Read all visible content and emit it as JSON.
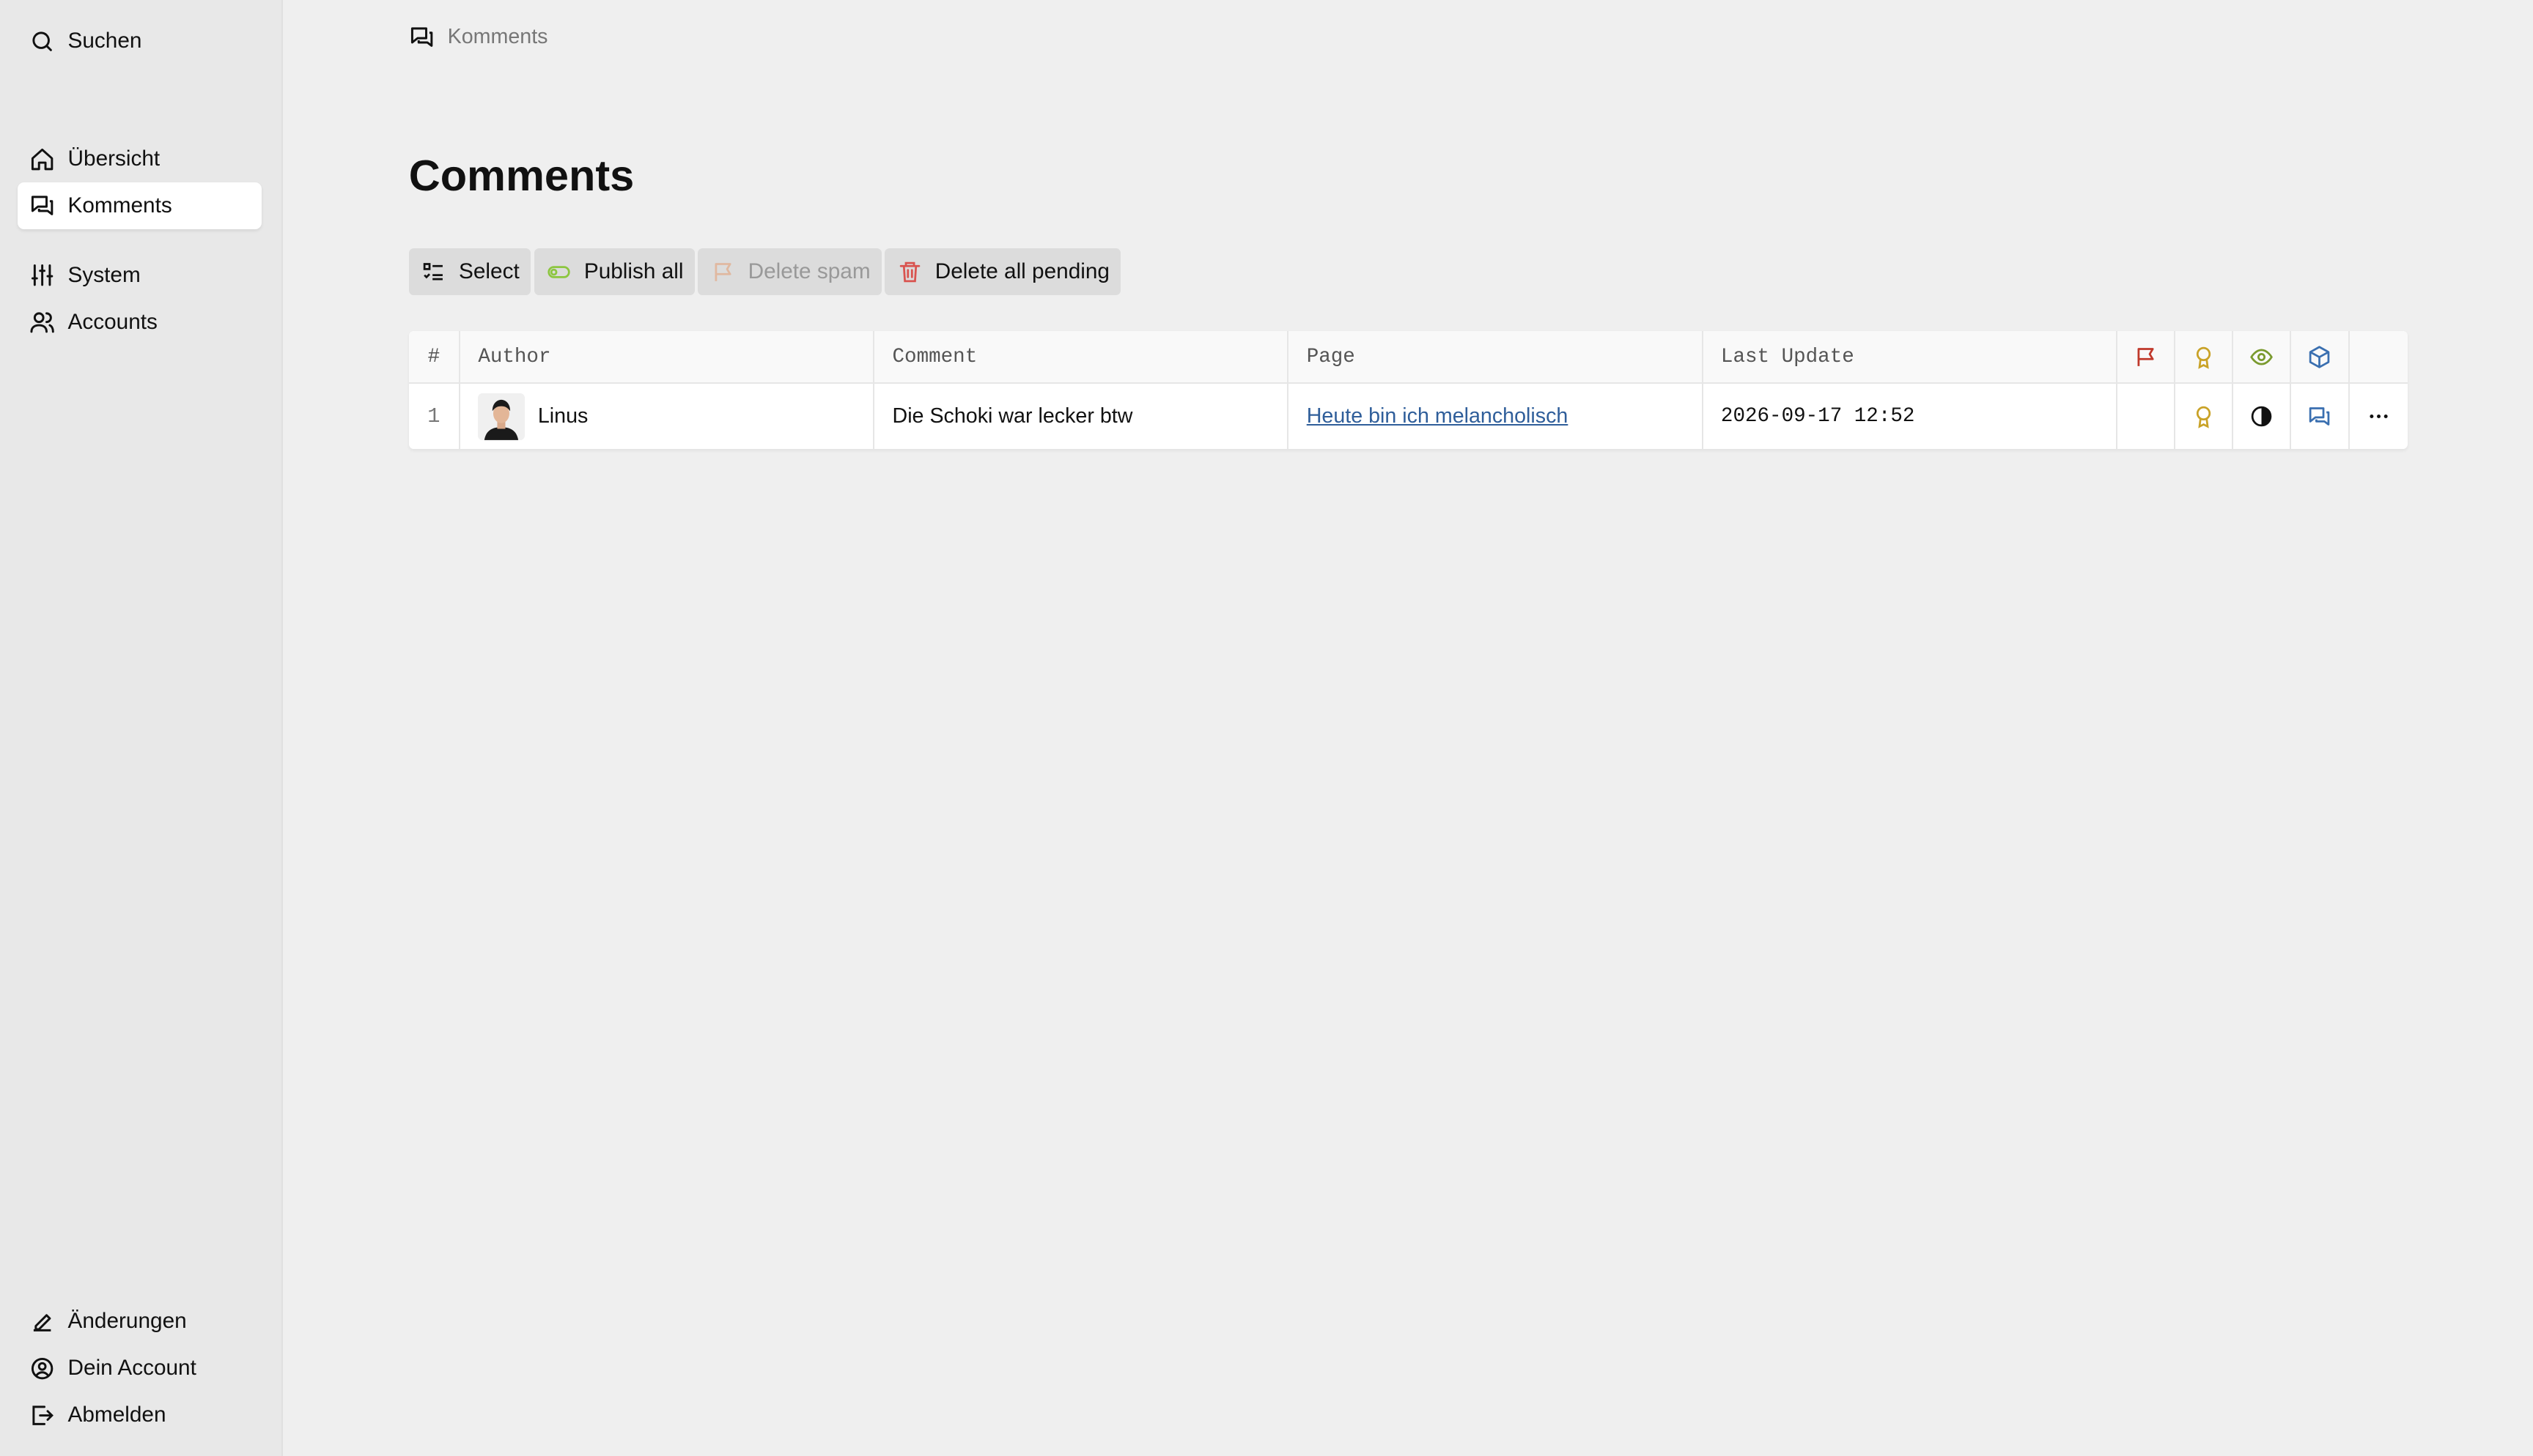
{
  "sidebar": {
    "search_label": "Suchen",
    "items": [
      {
        "label": "Übersicht",
        "icon": "home-icon"
      },
      {
        "label": "Komments",
        "icon": "comments-icon",
        "active": true
      },
      {
        "label": "System",
        "icon": "sliders-icon"
      },
      {
        "label": "Accounts",
        "icon": "users-icon"
      }
    ],
    "bottom": [
      {
        "label": "Änderungen",
        "icon": "pencil-icon"
      },
      {
        "label": "Dein Account",
        "icon": "user-circle-icon"
      },
      {
        "label": "Abmelden",
        "icon": "logout-icon"
      }
    ]
  },
  "breadcrumb": {
    "label": "Komments"
  },
  "page": {
    "title": "Comments"
  },
  "toolbar": {
    "select_label": "Select",
    "publish_label": "Publish all",
    "delete_spam_label": "Delete spam",
    "delete_pending_label": "Delete all pending"
  },
  "table": {
    "headers": {
      "num": "#",
      "author": "Author",
      "comment": "Comment",
      "page": "Page",
      "last_update": "Last Update"
    },
    "icon_columns": [
      "flag-icon",
      "award-icon",
      "eye-icon",
      "cube-icon"
    ],
    "rows": [
      {
        "num": "1",
        "author": "Linus",
        "comment": "Die Schoki war lecker btw",
        "page": "Heute bin ich melancholisch",
        "last_update": "2026-09-17 12:52"
      }
    ]
  },
  "colors": {
    "flag": "#c0392b",
    "award": "#c9a227",
    "eye": "#7a9a2e",
    "cube": "#3a6fb0",
    "link": "#2f5e9a",
    "delete": "#d9534f",
    "toggle": "#8cc63f"
  }
}
